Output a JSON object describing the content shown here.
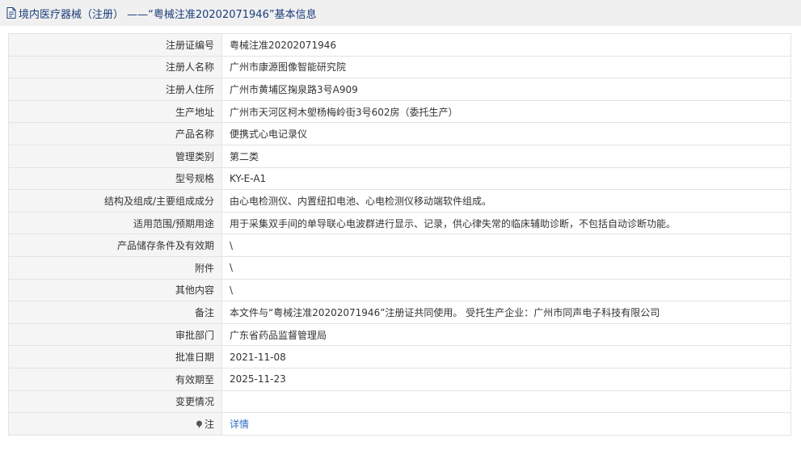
{
  "header": {
    "title": "境内医疗器械（注册） ——“粤械注准20202071946”基本信息",
    "icon": "document-icon"
  },
  "rows": [
    {
      "key": "reg-no",
      "label": "注册证编号",
      "value": "粤械注准20202071946"
    },
    {
      "key": "registrant-name",
      "label": "注册人名称",
      "value": "广州市康源图像智能研究院"
    },
    {
      "key": "registrant-address",
      "label": "注册人住所",
      "value": "广州市黄埔区掬泉路3号A909"
    },
    {
      "key": "production-address",
      "label": "生产地址",
      "value": "广州市天河区柯木塱杨梅岭街3号602房（委托生产）"
    },
    {
      "key": "product-name",
      "label": "产品名称",
      "value": "便携式心电记录仪"
    },
    {
      "key": "management-class",
      "label": "管理类别",
      "value": "第二类"
    },
    {
      "key": "model-spec",
      "label": "型号规格",
      "value": "KY-E-A1"
    },
    {
      "key": "structure",
      "label": "结构及组成/主要组成成分",
      "value": "由心电检测仪、内置纽扣电池、心电检测仪移动端软件组成。"
    },
    {
      "key": "scope",
      "label": "适用范围/预期用途",
      "value": "用于采集双手间的单导联心电波群进行显示、记录，供心律失常的临床辅助诊断，不包括自动诊断功能。"
    },
    {
      "key": "storage",
      "label": "产品储存条件及有效期",
      "value": "\\"
    },
    {
      "key": "attachment",
      "label": "附件",
      "value": "\\"
    },
    {
      "key": "other",
      "label": "其他内容",
      "value": "\\"
    },
    {
      "key": "remark",
      "label": "备注",
      "value": "本文件与“粤械注准20202071946”注册证共同使用。 受托生产企业：广州市同声电子科技有限公司"
    },
    {
      "key": "approval-dept",
      "label": "审批部门",
      "value": "广东省药品监督管理局"
    },
    {
      "key": "approval-date",
      "label": "批准日期",
      "value": "2021-11-08"
    },
    {
      "key": "valid-until",
      "label": "有效期至",
      "value": "2025-11-23"
    },
    {
      "key": "change",
      "label": "变更情况",
      "value": ""
    }
  ],
  "note": {
    "label": "注",
    "icon": "pin-icon",
    "link_text": "详情"
  }
}
